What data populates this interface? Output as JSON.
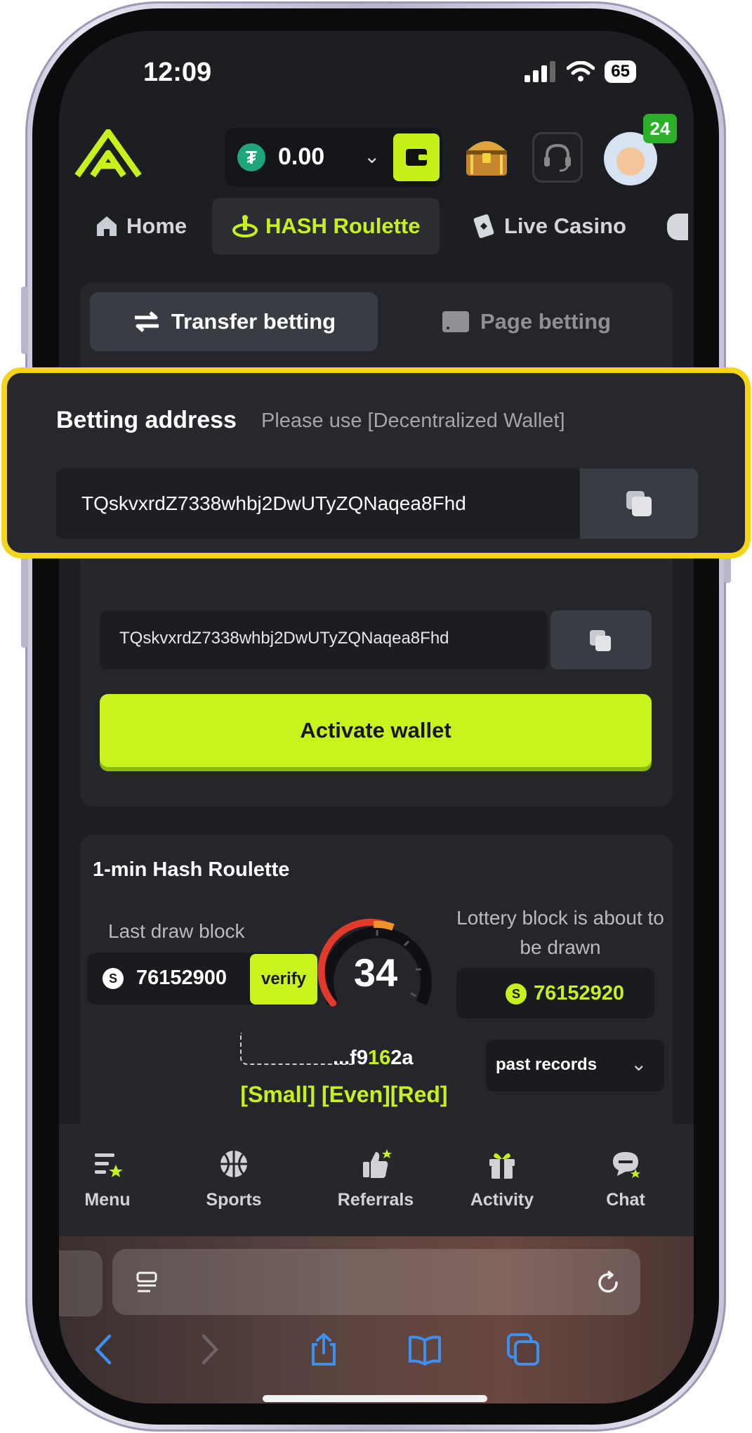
{
  "status_bar": {
    "time": "12:09",
    "battery": "65"
  },
  "header": {
    "balance": "0.00",
    "currency_icon": "usdt-icon",
    "notification_count": "24"
  },
  "nav_tabs": [
    {
      "label": "Home",
      "icon": "home-icon",
      "active": false
    },
    {
      "label": "HASH Roulette",
      "icon": "roulette-icon",
      "active": true
    },
    {
      "label": "Live Casino",
      "icon": "cards-icon",
      "active": false
    }
  ],
  "betting_type": {
    "transfer_label": "Transfer betting",
    "page_label": "Page betting"
  },
  "betting_address": {
    "title": "Betting address",
    "hint": "Please use [Decentralized Wallet]",
    "address": "TQskvxrdZ7338whbj2DwUTyZQNaqea8Fhd"
  },
  "wallet": {
    "address": "TQskvxrdZ7338whbj2DwUTyZQNaqea8Fhd",
    "activate_label": "Activate wallet"
  },
  "roulette": {
    "title": "1-min Hash Roulette",
    "last_draw_label": "Last draw block",
    "last_block": "76152900",
    "verify_label": "verify",
    "countdown": "34",
    "next_label": "Lottery block is about to be drawn",
    "next_block": "76152920",
    "hash_prefix": "...f9",
    "hash_highlight": "16",
    "hash_suffix": "2a",
    "result": "[Small] [Even][Red]",
    "past_records_label": "past records"
  },
  "bottom_nav": [
    {
      "label": "Menu",
      "icon": "menu-icon"
    },
    {
      "label": "Sports",
      "icon": "basketball-icon"
    },
    {
      "label": "Referrals",
      "icon": "thumbs-up-icon"
    },
    {
      "label": "Activity",
      "icon": "gift-icon"
    },
    {
      "label": "Chat",
      "icon": "chat-icon"
    }
  ],
  "colors": {
    "accent": "#c9f31c",
    "background": "#1d1e22",
    "card": "#25262b",
    "highlight_border": "#f4d51a",
    "browser_blue": "#3d8ff0"
  }
}
